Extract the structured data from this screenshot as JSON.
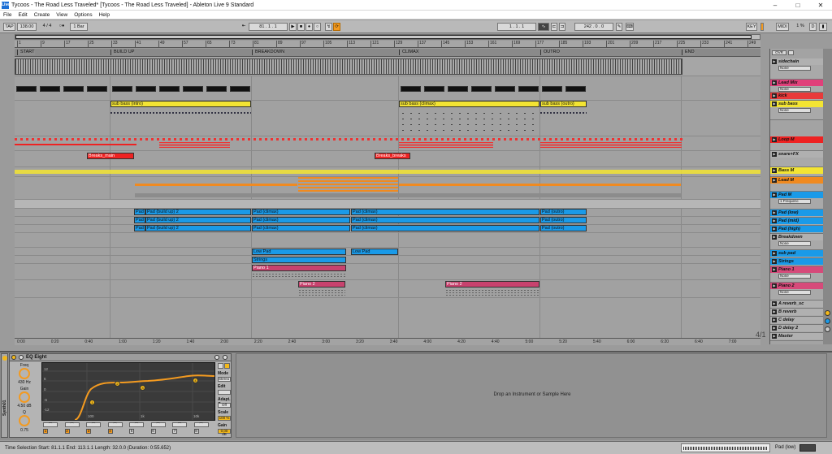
{
  "window": {
    "title": "Tycoos - The Road Less Traveled*  [Tycoos - The Road Less Traveled] - Ableton Live 9 Standard",
    "logo": "Live"
  },
  "menu": [
    "File",
    "Edit",
    "Create",
    "View",
    "Options",
    "Help"
  ],
  "transport": {
    "tap": "TAP",
    "tempo": "138.00",
    "meter": "4 / 4",
    "metro": "○●",
    "quant": "1 Bar",
    "position": "81 .  1 .  1",
    "loop_start": "1 .  1 .  1",
    "loop_len": "242 .  0 .  0",
    "key": "KEY",
    "midi": "MIDI",
    "cpu": "1 %",
    "d_label": "D"
  },
  "ruler_ticks": [
    "1",
    "9",
    "17",
    "25",
    "33",
    "41",
    "49",
    "57",
    "65",
    "73",
    "81",
    "89",
    "97",
    "105",
    "113",
    "121",
    "129",
    "137",
    "145",
    "153",
    "161",
    "169",
    "177",
    "185",
    "193",
    "201",
    "209",
    "217",
    "225",
    "233",
    "241",
    "249"
  ],
  "locators": [
    {
      "label": "START"
    },
    {
      "label": "BUILD UP"
    },
    {
      "label": "BREAKDOWN"
    },
    {
      "label": "CLIMAX"
    },
    {
      "label": "OUTRO"
    },
    {
      "label": "END"
    }
  ],
  "clips": {
    "sub_bass_intro": "sub bass (intro)",
    "sub_bass_climax": "sub bass (climax)",
    "sub_bass_outro": "sub bass (outro)",
    "breaks_main": "Breaks_main",
    "breaks_breaks": "Breaks_breaks",
    "pad_a": "Pad",
    "pad_build_1": "Pad (build up) 2",
    "pad_climax": "Pad (climax)",
    "pad_outro": "Pad (outro)",
    "low_pad": "Low Pad",
    "strings": "Strings",
    "piano1": "Piano 1",
    "piano2": "Piano 2"
  },
  "tracks": [
    {
      "name": "sidechain",
      "dd": "None",
      "color": "#b0b0b0"
    },
    {
      "name": "Lead Mix",
      "dd": "None",
      "color": "#e0407a"
    },
    {
      "name": "kick",
      "color": "#e83a3a"
    },
    {
      "name": "sub bass",
      "dd": "None",
      "color": "#f3e433"
    },
    {
      "name": "Loop M",
      "color": "#ee2222"
    },
    {
      "name": "snare+FX",
      "color": "#b0b0b0"
    },
    {
      "name": "Bass M",
      "color": "#f3e433"
    },
    {
      "name": "Lead M",
      "color": "#f08a20"
    },
    {
      "name": "Pad M",
      "dd": "1 Frequenc",
      "color": "#1a9ae8"
    },
    {
      "name": "Pad (low)",
      "color": "#1a9ae8"
    },
    {
      "name": "Pad (mid)",
      "color": "#1a9ae8"
    },
    {
      "name": "Pad (high)",
      "color": "#1a9ae8"
    },
    {
      "name": "Breakdown",
      "dd": "None",
      "color": "#b0b0b0"
    },
    {
      "name": "sub pad",
      "color": "#1a9ae8"
    },
    {
      "name": "Strings",
      "color": "#1a9ae8"
    },
    {
      "name": "Piano 1",
      "dd": "None",
      "color": "#d64a7a"
    },
    {
      "name": "Piano 2",
      "dd": "None",
      "color": "#d64a7a"
    },
    {
      "name": "A reverb_sc",
      "color": "#b0b0b0"
    },
    {
      "name": "B reverb",
      "color": "#b0b0b0"
    },
    {
      "name": "C delay",
      "color": "#b0b0b0"
    },
    {
      "name": "D delay 2",
      "color": "#b0b0b0"
    },
    {
      "name": "Master",
      "color": "#b0b0b0"
    }
  ],
  "time_axis": [
    "0:00",
    "0:20",
    "0:40",
    "1:00",
    "1:20",
    "1:40",
    "2:00",
    "2:20",
    "2:40",
    "3:00",
    "3:20",
    "3:40",
    "4:00",
    "4:20",
    "4:40",
    "5:00",
    "5:20",
    "5:40",
    "6:00",
    "6:20",
    "6:40",
    "7:00"
  ],
  "zoom": "4/1",
  "device": {
    "title": "EQ Eight",
    "chain_label": "Synth01",
    "freq_label": "Freq",
    "freq_value": "430 Hz",
    "gain_label": "Gain",
    "gain_value": "4.50 dB",
    "q_label": "Q",
    "q_value": "0.75",
    "mode_label": "Mode",
    "mode_value": "Stereo",
    "edit_label": "Edit",
    "adapt_label": "Adapt. Q",
    "adapt_value": "Off",
    "scale_label": "Scale",
    "scale_value": "100 %",
    "out_label": "Gain",
    "out_value": "0.00 dB",
    "db_ticks": [
      "12",
      "6",
      "0",
      "-6",
      "-12"
    ],
    "hz_ticks": [
      "100",
      "1k",
      "10k"
    ],
    "bands": [
      "1",
      "2",
      "3",
      "4",
      "5",
      "6",
      "7",
      "8"
    ]
  },
  "drop_message": "Drop an Instrument or Sample Here",
  "status": {
    "selection": "Time Selection   Start: 81.1.1   End: 113.1.1   Length: 32.0.0   (Duration: 0:55.652)",
    "right": "Pad (low)"
  }
}
